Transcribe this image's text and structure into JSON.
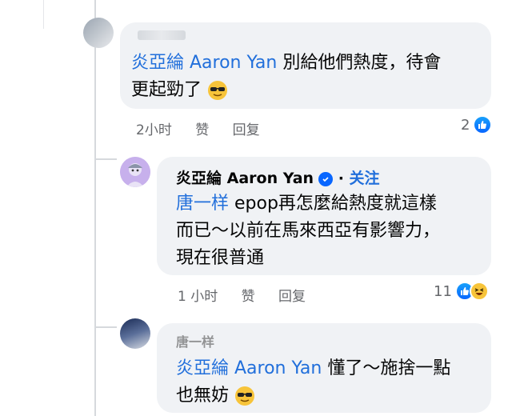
{
  "comments": [
    {
      "author": "",
      "mention": "炎亞綸 Aaron Yan",
      "text_line1": " 別給他們熱度，待會",
      "text_line2": "更起勁了",
      "emoji": "sunglasses-face",
      "time": "2小时",
      "like": "赞",
      "reply": "回复",
      "reaction_count": "2"
    },
    {
      "author": "炎亞綸 Aaron Yan",
      "follow": "关注",
      "mention": "唐一样",
      "text_line1": " epop再怎麼給熱度就這樣",
      "text_line2": "而已～以前在馬來西亞有影響力，",
      "text_line3": "現在很普通",
      "time": "1 小时",
      "like": "赞",
      "reply": "回复",
      "reaction_count": "11"
    },
    {
      "author": "唐一样",
      "mention": "炎亞綸 Aaron Yan",
      "text_line1": " 懂了～施捨一點",
      "text_line2": "也無妨",
      "emoji": "sunglasses-face"
    }
  ],
  "colors": {
    "mention": "#216fdb",
    "bubble": "#f0f2f5",
    "like": "#0866ff"
  }
}
